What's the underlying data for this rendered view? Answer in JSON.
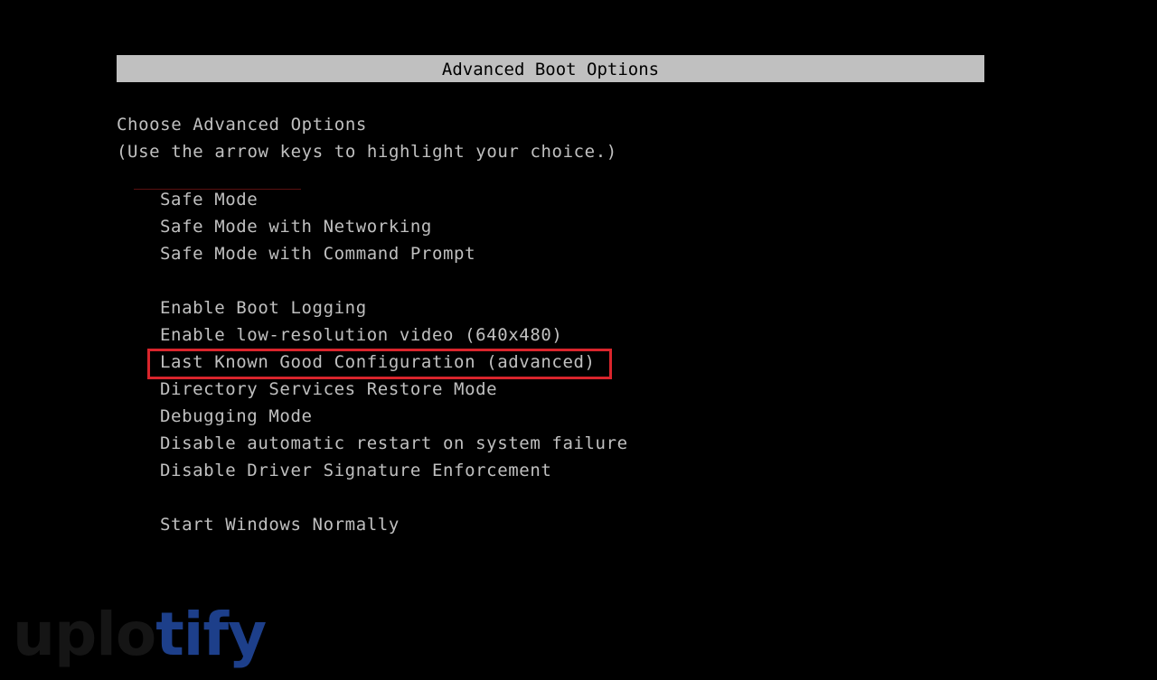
{
  "header": {
    "title": "Advanced Boot Options"
  },
  "intro": {
    "heading": "Choose Advanced Options",
    "hint": "(Use the arrow keys to highlight your choice.)"
  },
  "options": [
    "Safe Mode",
    "Safe Mode with Networking",
    "Safe Mode with Command Prompt",
    "Enable Boot Logging",
    "Enable low-resolution video (640x480)",
    "Last Known Good Configuration (advanced)",
    "Directory Services Restore Mode",
    "Debugging Mode",
    "Disable automatic restart on system failure",
    "Disable Driver Signature Enforcement",
    "Start Windows Normally"
  ],
  "highlighted_option": "Last Known Good Configuration (advanced)",
  "highlight_color": "#d9252c",
  "watermark": {
    "part1": "uplo",
    "part2": "tify",
    "color1": "#151515",
    "color2": "#1d3f8a"
  }
}
